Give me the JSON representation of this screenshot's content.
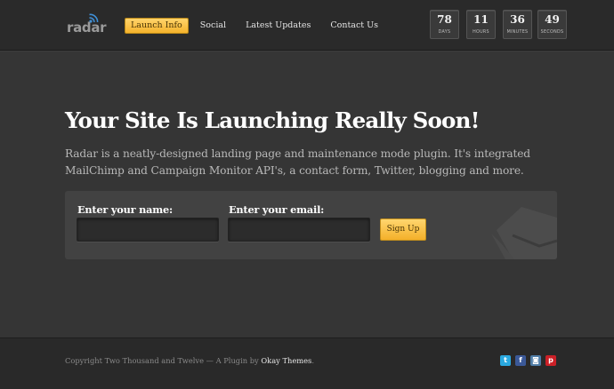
{
  "header": {
    "logo_text": "radar",
    "nav": [
      {
        "label": "Launch Info",
        "active": true
      },
      {
        "label": "Social",
        "active": false
      },
      {
        "label": "Latest Updates",
        "active": false
      },
      {
        "label": "Contact Us",
        "active": false
      }
    ],
    "countdown": [
      {
        "value": "78",
        "label": "DAYS"
      },
      {
        "value": "11",
        "label": "HOURS"
      },
      {
        "value": "36",
        "label": "MINUTES"
      },
      {
        "value": "49",
        "label": "SECONDS"
      }
    ]
  },
  "main": {
    "headline": "Your Site Is Launching Really Soon!",
    "intro": "Radar is a neatly-designed landing page and maintenance mode plugin. It's integrated MailChimp and Campaign Monitor API's, a contact form, Twitter, blogging and more.",
    "form": {
      "name_label": "Enter your name:",
      "name_value": "",
      "email_label": "Enter your email:",
      "email_value": "",
      "submit_label": "Sign Up"
    }
  },
  "footer": {
    "copyright_prefix": "Copyright Two Thousand and Twelve — A Plugin by ",
    "brand": "Okay Themes",
    "copyright_suffix": ".",
    "social": [
      {
        "icon": "twitter-icon",
        "glyph": "t",
        "color": "#2aa9e0"
      },
      {
        "icon": "facebook-icon",
        "glyph": "f",
        "color": "#3b5998"
      },
      {
        "icon": "instagram-icon",
        "glyph": "◙",
        "color": "#4f7ca6"
      },
      {
        "icon": "pinterest-icon",
        "glyph": "p",
        "color": "#cb2027"
      }
    ]
  },
  "colors": {
    "accent": "#f5b32c",
    "background": "#353535",
    "header": "#2a2a2a"
  }
}
